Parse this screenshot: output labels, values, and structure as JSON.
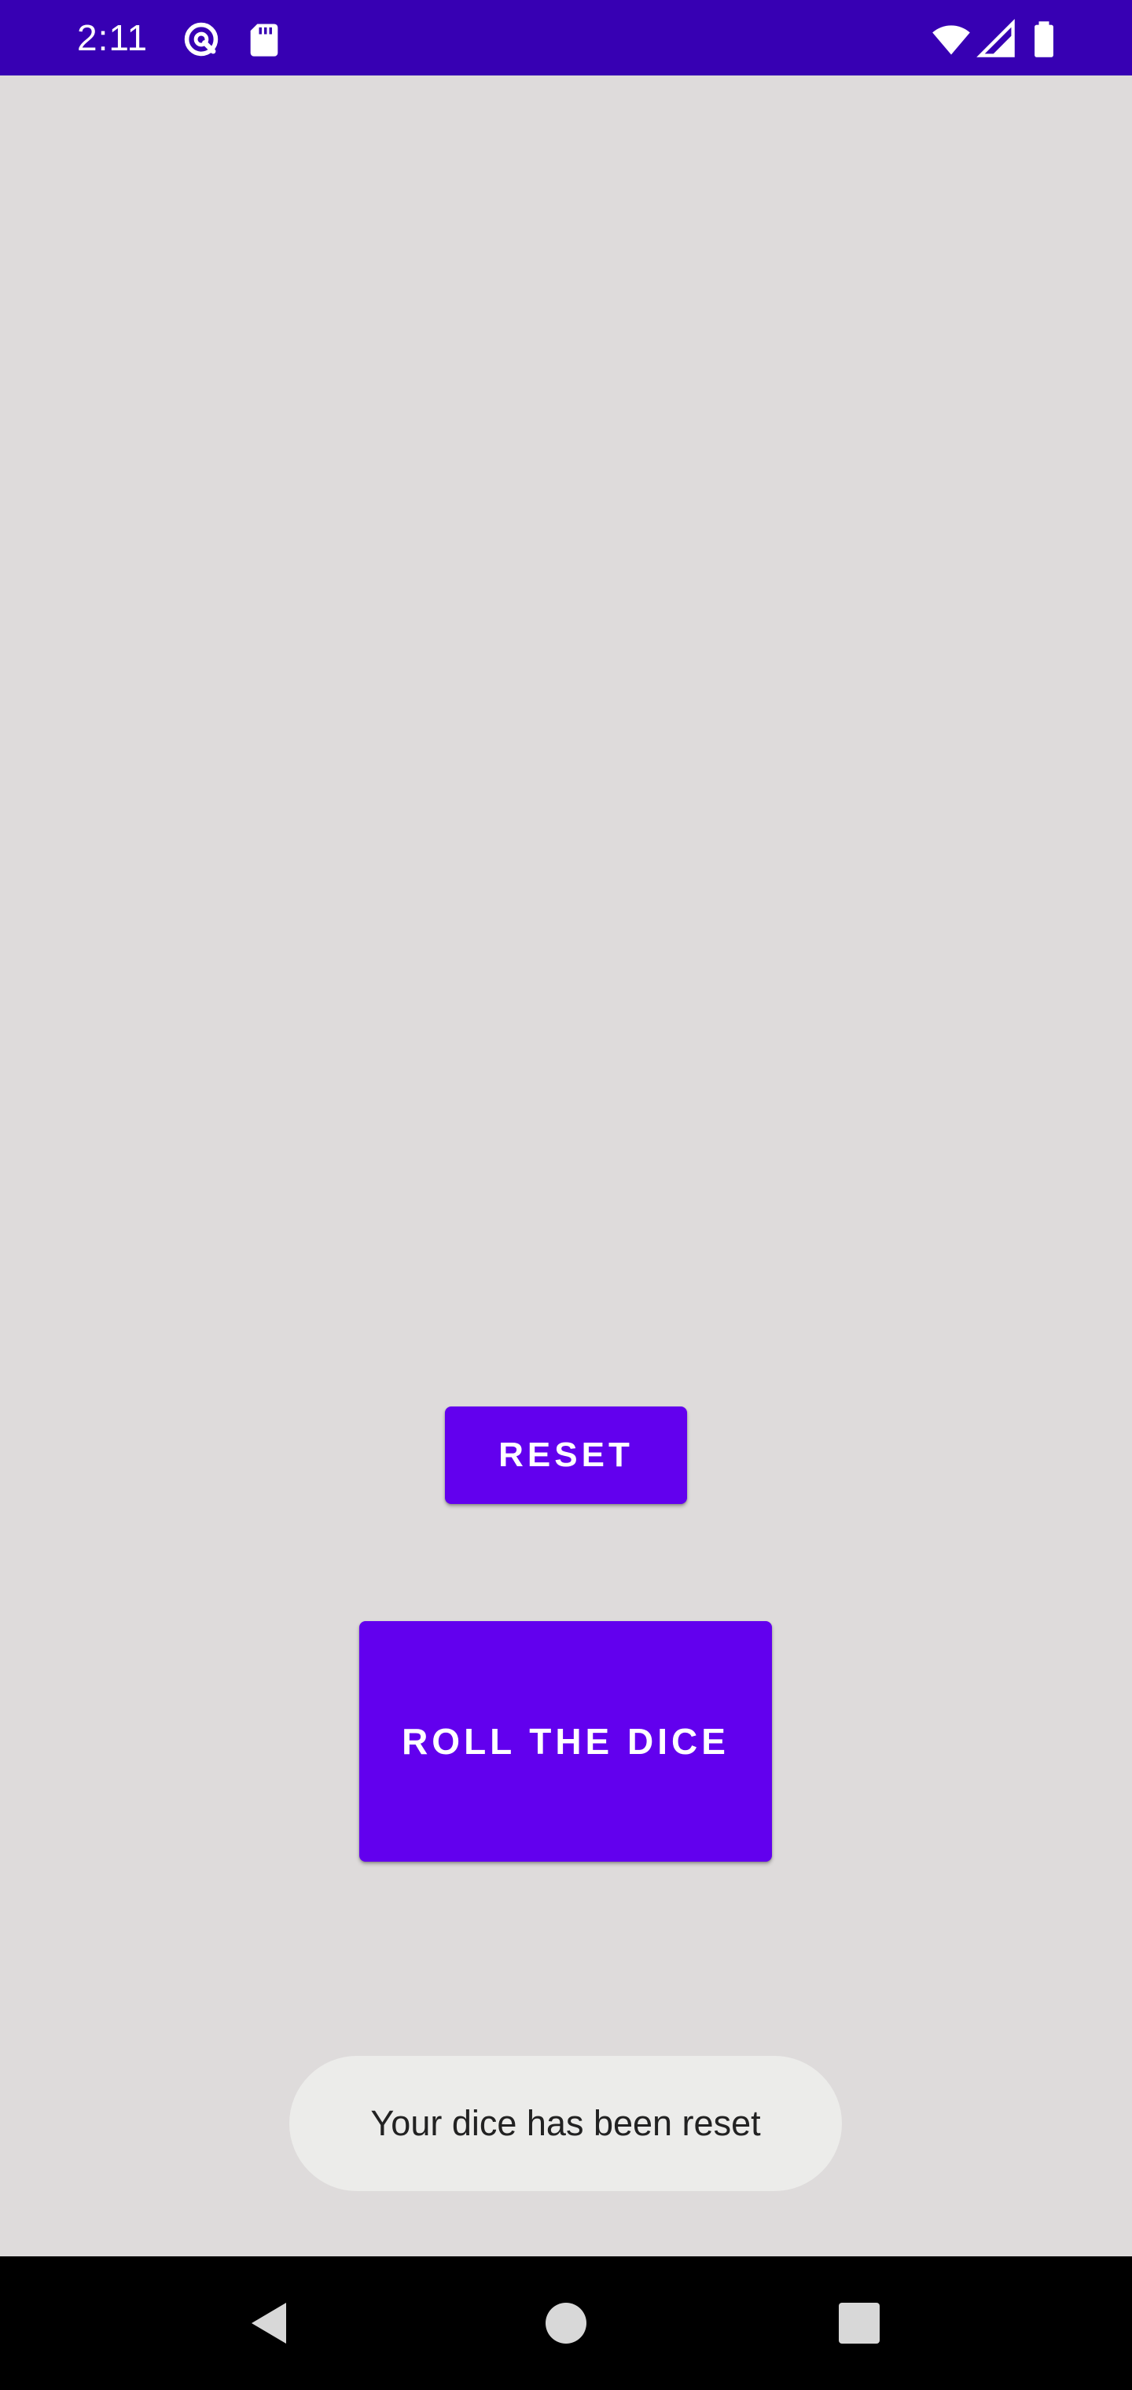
{
  "status_bar": {
    "time": "2:11",
    "icons": [
      "data-saver-icon",
      "sd-card-icon",
      "wifi-icon",
      "cell-signal-icon",
      "battery-icon"
    ],
    "background": "#3700b3"
  },
  "main": {
    "background": "#dedbdb",
    "reset_button_label": "RESET",
    "roll_button_label": "ROLL THE DICE",
    "accent": "#6200ee"
  },
  "toast": {
    "message": "Your dice has been reset"
  },
  "nav_bar": {
    "icons": [
      "back-icon",
      "home-icon",
      "recents-icon"
    ]
  }
}
